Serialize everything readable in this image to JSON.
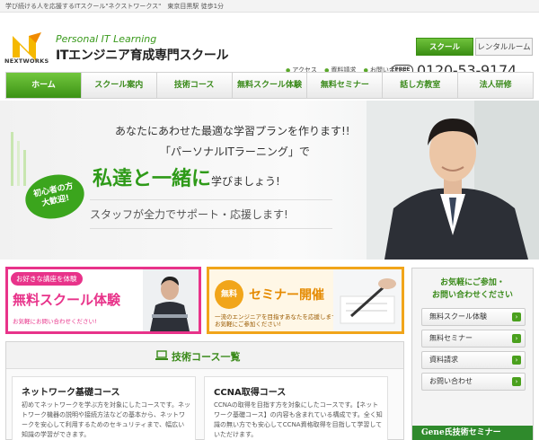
{
  "topbar": {
    "text": "学び続ける人を応援するITスクール\"ネクストワークス\"　東京目黒駅 徒歩1分"
  },
  "header": {
    "logo_text": "NEXTWORKS",
    "brand_sub": "Personal IT Learning",
    "brand_title": "ITエンジニア育成専門スクール",
    "tabs": [
      {
        "label": "スクール"
      },
      {
        "label": "レンタルルーム"
      }
    ],
    "links": [
      {
        "label": "アクセス"
      },
      {
        "label": "資料請求"
      },
      {
        "label": "お問い合わせ"
      }
    ],
    "freecall_label": "FREE",
    "phone": "0120-53-9174"
  },
  "nav": {
    "items": [
      {
        "label": "ホーム"
      },
      {
        "label": "スクール案内"
      },
      {
        "label": "技術コース"
      },
      {
        "label": "無料スクール体験"
      },
      {
        "label": "無料セミナー"
      },
      {
        "label": "話し方教室"
      },
      {
        "label": "法人研修"
      }
    ]
  },
  "hero": {
    "line1": "あなたにあわせた最適な学習プランを作ります!!",
    "line2": "「パーソナルITラーニング」で",
    "line3_big": "私達と一緒に",
    "line3_rest": "学びましょう!",
    "line4": "スタッフが全力でサポート・応援します!",
    "badge_line1": "初心者の方",
    "badge_line2": "大歓迎!"
  },
  "banners": {
    "trial": {
      "tag": "お好きな講座を体験",
      "title": "無料スクール体験",
      "note": "お気軽にお問い合わせください!"
    },
    "seminar": {
      "circle": "無料",
      "title": "セミナー開催",
      "note1": "一流のエンジニアを目指すあなたを応援します。",
      "note2": "お気軽にご参加ください!"
    }
  },
  "sidebar": {
    "title1": "お気軽にご参加・",
    "title2": "お問い合わせください",
    "buttons": [
      {
        "label": "無料スクール体験"
      },
      {
        "label": "無料セミナー"
      },
      {
        "label": "資料請求"
      },
      {
        "label": "お問い合わせ"
      }
    ],
    "gene_label": "Gene氏技術セミナー"
  },
  "courses": {
    "title": "技術コース一覧",
    "items": [
      {
        "title": "ネットワーク基礎コース",
        "desc": "初めてネットワークを学ぶ方を対象にしたコースです。ネットワーク機器の説明や接続方法などの基本から、ネットワークを安心して利用するためのセキュリティまで、幅広い知識の学習ができます。"
      },
      {
        "title": "CCNA取得コース",
        "desc": "CCNAの取得を目指す方を対象にしたコースです。【ネットワーク基礎コース】の内容も含まれている構成です。全く知識の無い方でも安心してCCNA資格取得を目指して学習していただけます。"
      }
    ]
  },
  "colors": {
    "brand_green": "#3b9214",
    "pink": "#e8338a",
    "orange": "#f1a51a"
  }
}
